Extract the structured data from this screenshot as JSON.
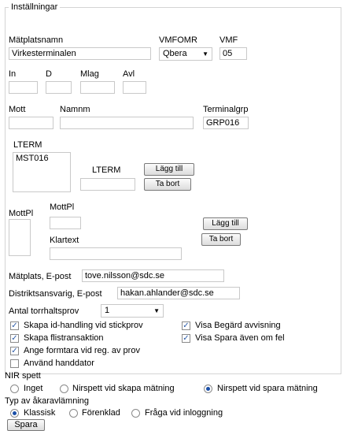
{
  "fieldset": {
    "legend": "Inställningar"
  },
  "matplatsnamn": {
    "label": "Mätplatsnamn",
    "value": "Virkesterminalen"
  },
  "vmfomr": {
    "label": "VMFOMR",
    "value": "Qbera"
  },
  "vmf": {
    "label": "VMF",
    "value": "05"
  },
  "in": {
    "label": "In",
    "value": ""
  },
  "d": {
    "label": "D",
    "value": ""
  },
  "mlag": {
    "label": "Mlag",
    "value": ""
  },
  "avl": {
    "label": "Avl",
    "value": ""
  },
  "mott": {
    "label": "Mott",
    "value": ""
  },
  "namnm": {
    "label": "Namnm",
    "value": ""
  },
  "terminalgrp": {
    "label": "Terminalgrp",
    "value": "GRP016"
  },
  "lterm": {
    "list_label": "LTERM",
    "items": [
      "MST016"
    ],
    "input_label": "LTERM",
    "input_value": "",
    "add_label": "Lägg till",
    "remove_label": "Ta bort"
  },
  "mottpl": {
    "list_label": "MottPl",
    "items": [],
    "input_label": "MottPl",
    "input_value": "",
    "klartext_label": "Klartext",
    "klartext_value": "",
    "add_label": "Lägg till",
    "remove_label": "Ta bort"
  },
  "matplats_epost": {
    "label": "Mätplats, E-post",
    "value": "tove.nilsson@sdc.se"
  },
  "distrikt_epost": {
    "label": "Distriktsansvarig, E-post",
    "value": "hakan.ahlander@sdc.se"
  },
  "torrhaltsprov": {
    "label": "Antal torrhaltsprov",
    "value": "1"
  },
  "checkboxes": {
    "skapa_id": {
      "label": "Skapa id-handling vid stickprov",
      "checked": true
    },
    "visa_begard": {
      "label": "Visa Begärd avvisning",
      "checked": true
    },
    "skapa_flis": {
      "label": "Skapa flistransaktion",
      "checked": true
    },
    "visa_spara": {
      "label": "Visa Spara även om fel",
      "checked": true
    },
    "ange_formtara": {
      "label": "Ange formtara vid reg. av prov",
      "checked": true
    },
    "anvand_handdator": {
      "label": "Använd handdator",
      "checked": false
    }
  },
  "nir": {
    "label": "NIR spett",
    "options": [
      "Inget",
      "Nirspett vid skapa mätning",
      "Nirspett vid spara mätning"
    ],
    "selected_index": 2
  },
  "akaravlamning": {
    "label": "Typ av åkaravlämning",
    "options": [
      "Klassisk",
      "Förenklad",
      "Fråga vid inloggning"
    ],
    "selected_index": 0
  },
  "save_label": "Spara",
  "colors": {
    "check": "#2a5aa8",
    "radio": "#1a4fa8",
    "border": "#c9c9c9"
  }
}
